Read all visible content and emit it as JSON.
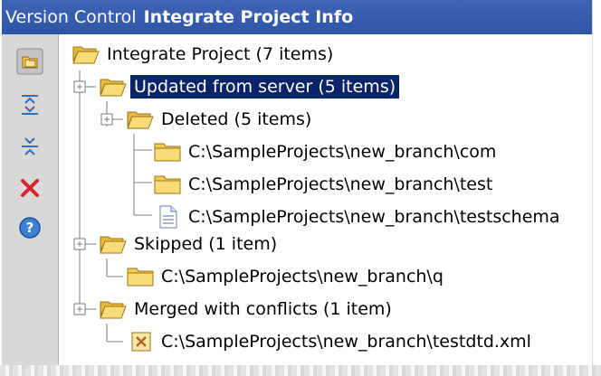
{
  "title": {
    "tool_window": "Version Control",
    "panel": "Integrate Project Info"
  },
  "toolbar": {
    "icons": [
      {
        "name": "group-by-directory-icon"
      },
      {
        "name": "expand-all-icon"
      },
      {
        "name": "collapse-all-icon"
      },
      {
        "name": "close-icon"
      },
      {
        "name": "help-icon"
      }
    ]
  },
  "tree": {
    "root": "Integrate Project (7 items)",
    "updated": "Updated from server (5 items)",
    "deleted": "Deleted (5 items)",
    "deleted_items": [
      "C:\\SampleProjects\\new_branch\\com",
      "C:\\SampleProjects\\new_branch\\test",
      "C:\\SampleProjects\\new_branch\\testschema"
    ],
    "skipped": "Skipped (1 item)",
    "skipped_items": [
      "C:\\SampleProjects\\new_branch\\q"
    ],
    "merged": "Merged with conflicts (1 item)",
    "merged_items": [
      "C:\\SampleProjects\\new_branch\\testdtd.xml"
    ]
  },
  "colors": {
    "title_bar": "#2f55a8",
    "selection": "#0a246a",
    "folder": "#f5d060",
    "toolbar_bg": "#d8d8d8"
  }
}
